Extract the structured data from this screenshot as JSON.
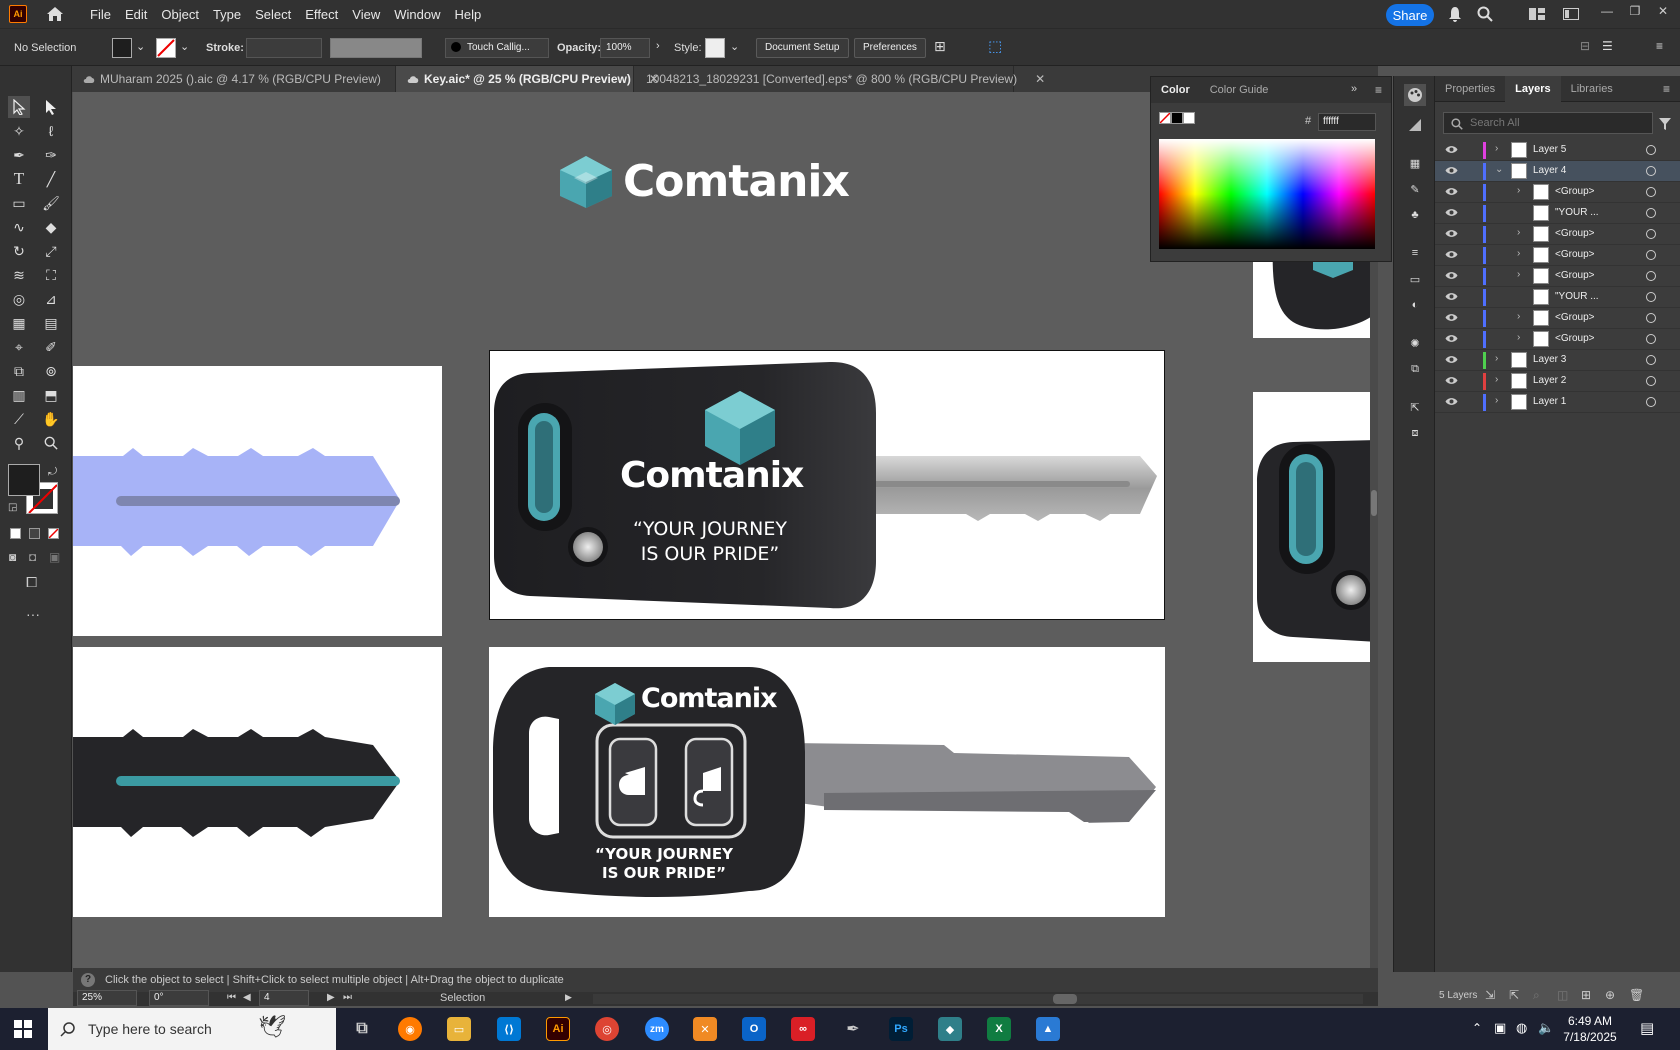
{
  "app": {
    "logo": "Ai"
  },
  "menu": [
    "File",
    "Edit",
    "Object",
    "Type",
    "Select",
    "Effect",
    "View",
    "Window",
    "Help"
  ],
  "share_label": "Share",
  "control": {
    "selection": "No Selection",
    "stroke_label": "Stroke:",
    "brush": "Touch Callig...",
    "opacity_label": "Opacity:",
    "opacity_value": "100%",
    "style_label": "Style:",
    "doc_setup": "Document Setup",
    "preferences": "Preferences"
  },
  "tabs": [
    {
      "label": "MUharam 2025 ().aic @ 4.17 % (RGB/CPU Preview)",
      "active": false
    },
    {
      "label": "Key.aic* @ 25 % (RGB/CPU Preview)",
      "active": true
    },
    {
      "label": "10048213_18029231 [Converted].eps* @ 800 % (RGB/CPU Preview)",
      "active": false
    }
  ],
  "canvas": {
    "brand": "Comtanix",
    "slogan_line1": "“YOUR JOURNEY",
    "slogan_line2": "IS OUR PRIDE”"
  },
  "color_panel": {
    "tabs": [
      "Color",
      "Color Guide"
    ],
    "hex_label": "#",
    "hex_value": "ffffff"
  },
  "layers_panel": {
    "tabs": [
      "Properties",
      "Layers",
      "Libraries"
    ],
    "search_placeholder": "Search All",
    "rows": [
      {
        "name": "Layer 5",
        "level": 0,
        "color": "#e040e0",
        "expand": false,
        "selected": false
      },
      {
        "name": "Layer 4",
        "level": 0,
        "color": "#4f6fff",
        "expand": true,
        "selected": true
      },
      {
        "name": "<Group>",
        "level": 1,
        "color": "#4f6fff",
        "expand": false,
        "selected": false
      },
      {
        "name": "\"YOUR ...",
        "level": 1,
        "color": "#4f6fff",
        "expand": null,
        "selected": false
      },
      {
        "name": "<Group>",
        "level": 1,
        "color": "#4f6fff",
        "expand": false,
        "selected": false
      },
      {
        "name": "<Group>",
        "level": 1,
        "color": "#4f6fff",
        "expand": false,
        "selected": false
      },
      {
        "name": "<Group>",
        "level": 1,
        "color": "#4f6fff",
        "expand": false,
        "selected": false
      },
      {
        "name": "\"YOUR ...",
        "level": 1,
        "color": "#4f6fff",
        "expand": null,
        "selected": false
      },
      {
        "name": "<Group>",
        "level": 1,
        "color": "#4f6fff",
        "expand": false,
        "selected": false
      },
      {
        "name": "<Group>",
        "level": 1,
        "color": "#4f6fff",
        "expand": false,
        "selected": false
      },
      {
        "name": "Layer 3",
        "level": 0,
        "color": "#4fd04f",
        "expand": false,
        "selected": false
      },
      {
        "name": "Layer 2",
        "level": 0,
        "color": "#e04040",
        "expand": false,
        "selected": false
      },
      {
        "name": "Layer 1",
        "level": 0,
        "color": "#4f6fff",
        "expand": false,
        "selected": false
      }
    ],
    "footer": "5 Layers"
  },
  "status": {
    "hint": "Click the object to select  |  Shift+Click to select multiple object  |  Alt+Drag the object to duplicate",
    "zoom": "25%",
    "rotation": "0°",
    "artboard": "4",
    "tool": "Selection"
  },
  "taskbar": {
    "search_placeholder": "Type here to search",
    "time": "6:49 AM",
    "date": "7/18/2025"
  },
  "colors": {
    "accent": "#1473e6",
    "teal": "#4aa6b0",
    "key_body": "#252528"
  }
}
